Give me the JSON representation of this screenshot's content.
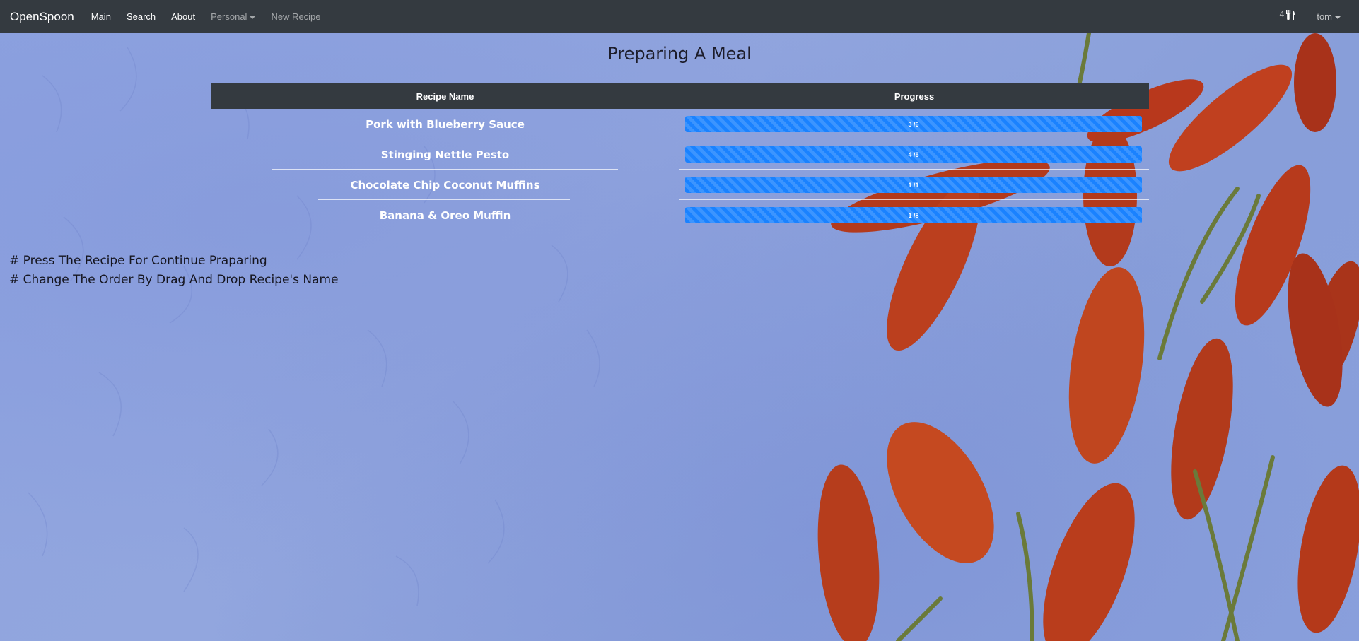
{
  "navbar": {
    "brand": "OpenSpoon",
    "items": [
      {
        "label": "Main"
      },
      {
        "label": "Search"
      },
      {
        "label": "About"
      },
      {
        "label": "Personal"
      },
      {
        "label": "New Recipe"
      }
    ],
    "cart_count": "4",
    "user": "tom"
  },
  "page": {
    "title": "Preparing A Meal"
  },
  "table": {
    "headers": {
      "name": "Recipe Name",
      "progress": "Progress"
    },
    "rows": [
      {
        "name": "Pork with Blueberry Sauce",
        "progress_label": "3 /6",
        "progress_fraction": 1.0
      },
      {
        "name": "Stinging Nettle Pesto",
        "progress_label": "4 /5",
        "progress_fraction": 1.0
      },
      {
        "name": "Chocolate Chip Coconut Muffins",
        "progress_label": "1 /1",
        "progress_fraction": 1.0
      },
      {
        "name": "Banana & Oreo Muffin",
        "progress_label": "1 /8",
        "progress_fraction": 1.0
      }
    ]
  },
  "hints": [
    "# Press The Recipe For Continue Praparing",
    "# Change The Order By Drag And Drop Recipe's Name"
  ],
  "colors": {
    "navbar": "#343a40",
    "progress": "#1a82ff",
    "background": "#8fa3dd"
  },
  "icons": {
    "cart": "utensils-icon"
  }
}
